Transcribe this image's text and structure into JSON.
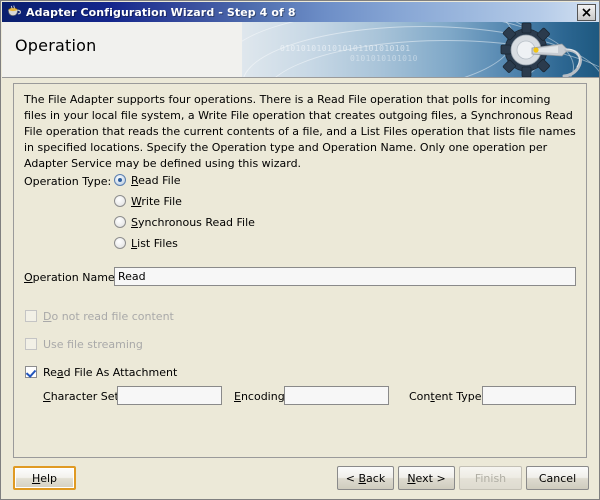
{
  "window": {
    "title": "Adapter Configuration Wizard - Step 4 of 8",
    "app_icon": "java-coffee-cup-icon",
    "close_label": "✖",
    "close_icon": "close-icon"
  },
  "banner": {
    "heading": "Operation",
    "artwork_icon": "gear-wrench-icon",
    "binary_text_line1": "0101010101010101101010101",
    "binary_text_line2": "0101010101010"
  },
  "panel": {
    "description": "The File Adapter supports four operations.  There is a Read File operation that polls for incoming files in your local file system, a Write File operation that creates outgoing files, a Synchronous Read File operation that reads the current contents of a file, and a List Files operation that lists file names in specified locations.  Specify the Operation type and Operation Name.  Only one operation per Adapter Service may be defined using this wizard.",
    "operation_type": {
      "label": "Operation Type:",
      "selected": "Read File",
      "options": [
        {
          "label": "Read File",
          "mnemonic": "R",
          "selected": true,
          "enabled": true
        },
        {
          "label": "Write File",
          "mnemonic": "W",
          "selected": false,
          "enabled": true
        },
        {
          "label": "Synchronous Read File",
          "mnemonic": "S",
          "selected": false,
          "enabled": true
        },
        {
          "label": "List Files",
          "mnemonic": "L",
          "selected": false,
          "enabled": true
        }
      ]
    },
    "operation_name": {
      "label": "Operation Name:",
      "mnemonic": "O",
      "value": "Read",
      "placeholder": ""
    },
    "checkboxes": [
      {
        "label": "Do not read file content",
        "mnemonic": "D",
        "checked": false,
        "enabled": false
      },
      {
        "label": "Use file streaming",
        "mnemonic": "",
        "checked": false,
        "enabled": false
      },
      {
        "label": "Read File As Attachment",
        "mnemonic": "a",
        "checked": true,
        "enabled": true
      }
    ],
    "fields": [
      {
        "label": "Character Set:",
        "mnemonic": "C",
        "value": "",
        "placeholder": ""
      },
      {
        "label": "Encoding:",
        "mnemonic": "E",
        "value": "",
        "placeholder": ""
      },
      {
        "label": "Content Type:",
        "mnemonic": "t",
        "value": "",
        "placeholder": ""
      }
    ]
  },
  "buttons": {
    "help": {
      "label": "Help",
      "enabled": true,
      "focused": true
    },
    "back": {
      "label": "< Back",
      "enabled": true,
      "focused": false
    },
    "next": {
      "label": "Next >",
      "enabled": true,
      "focused": false
    },
    "finish": {
      "label": "Finish",
      "enabled": false,
      "focused": false
    },
    "cancel": {
      "label": "Cancel",
      "enabled": true,
      "focused": false
    }
  },
  "colors": {
    "titlebar_start": "#0a1f6e",
    "titlebar_end": "#d4e2f2",
    "dialog_bg": "#ece9d8",
    "banner_blue": "#1d587f",
    "focus_ring": "#e09a23",
    "accent_blue": "#2f5f9e"
  }
}
